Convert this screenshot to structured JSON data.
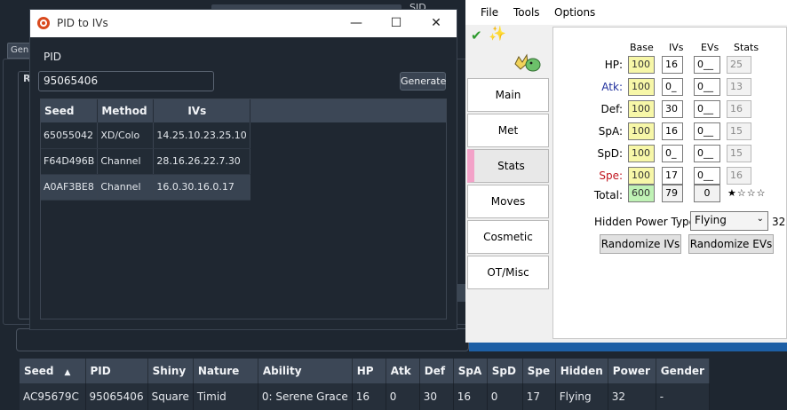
{
  "background": {
    "sid_label": "SID",
    "gen_tab": "Gen",
    "groupbox_label": "R"
  },
  "bottom_grid": {
    "columns": [
      "Seed",
      "PID",
      "Shiny",
      "Nature",
      "Ability",
      "HP",
      "Atk",
      "Def",
      "SpA",
      "SpD",
      "Spe",
      "Hidden",
      "Power",
      "Gender"
    ],
    "sort_indicator": "▲",
    "rows": [
      [
        "AC95679C",
        "95065406",
        "Square",
        "Timid",
        "0: Serene Grace",
        "16",
        "0",
        "30",
        "16",
        "0",
        "17",
        "Flying",
        "32",
        "-"
      ]
    ]
  },
  "pid_window": {
    "title": "PID to IVs",
    "pid_label": "PID",
    "pid_value": "95065406",
    "generate_label": "Generate",
    "columns": [
      "Seed",
      "Method",
      "IVs"
    ],
    "rows": [
      [
        "65055042",
        "XD/Colo",
        "14.25.10.23.25.10"
      ],
      [
        "F64D496B",
        "Channel",
        "28.16.26.22.7.30"
      ],
      [
        "A0AF3BE8",
        "Channel",
        "16.0.30.16.0.17"
      ]
    ],
    "selected_row": 2,
    "controls": {
      "minimize": "—",
      "maximize": "☐",
      "close": "✕"
    }
  },
  "editor": {
    "menu": [
      "File",
      "Tools",
      "Options"
    ],
    "check_icon": "✔",
    "sparkle_icon": "✨",
    "tabs": [
      "Main",
      "Met",
      "Stats",
      "Moves",
      "Cosmetic",
      "OT/Misc"
    ],
    "active_tab": "Stats",
    "headers": {
      "base": "Base",
      "ivs": "IVs",
      "evs": "EVs",
      "stats": "Stats"
    },
    "stat_rows": [
      {
        "label": "HP:",
        "base": "100",
        "iv": "16",
        "ev": "0__",
        "stat": "25",
        "color": "#000000"
      },
      {
        "label": "Atk:",
        "base": "100",
        "iv": "0_",
        "ev": "0__",
        "stat": "13",
        "color": "#1f2f9c"
      },
      {
        "label": "Def:",
        "base": "100",
        "iv": "30",
        "ev": "0__",
        "stat": "16",
        "color": "#000000"
      },
      {
        "label": "SpA:",
        "base": "100",
        "iv": "16",
        "ev": "0__",
        "stat": "15",
        "color": "#000000"
      },
      {
        "label": "SpD:",
        "base": "100",
        "iv": "0_",
        "ev": "0__",
        "stat": "15",
        "color": "#000000"
      },
      {
        "label": "Spe:",
        "base": "100",
        "iv": "17",
        "ev": "0__",
        "stat": "16",
        "color": "#c0141e"
      }
    ],
    "total": {
      "label": "Total:",
      "base": "600",
      "iv": "79",
      "ev": "0",
      "stars": "★☆☆☆"
    },
    "hidden_power": {
      "label": "Hidden Power Type:",
      "value": "Flying",
      "power": "32"
    },
    "randomize_ivs": "Randomize IVs",
    "randomize_evs": "Randomize EVs"
  }
}
